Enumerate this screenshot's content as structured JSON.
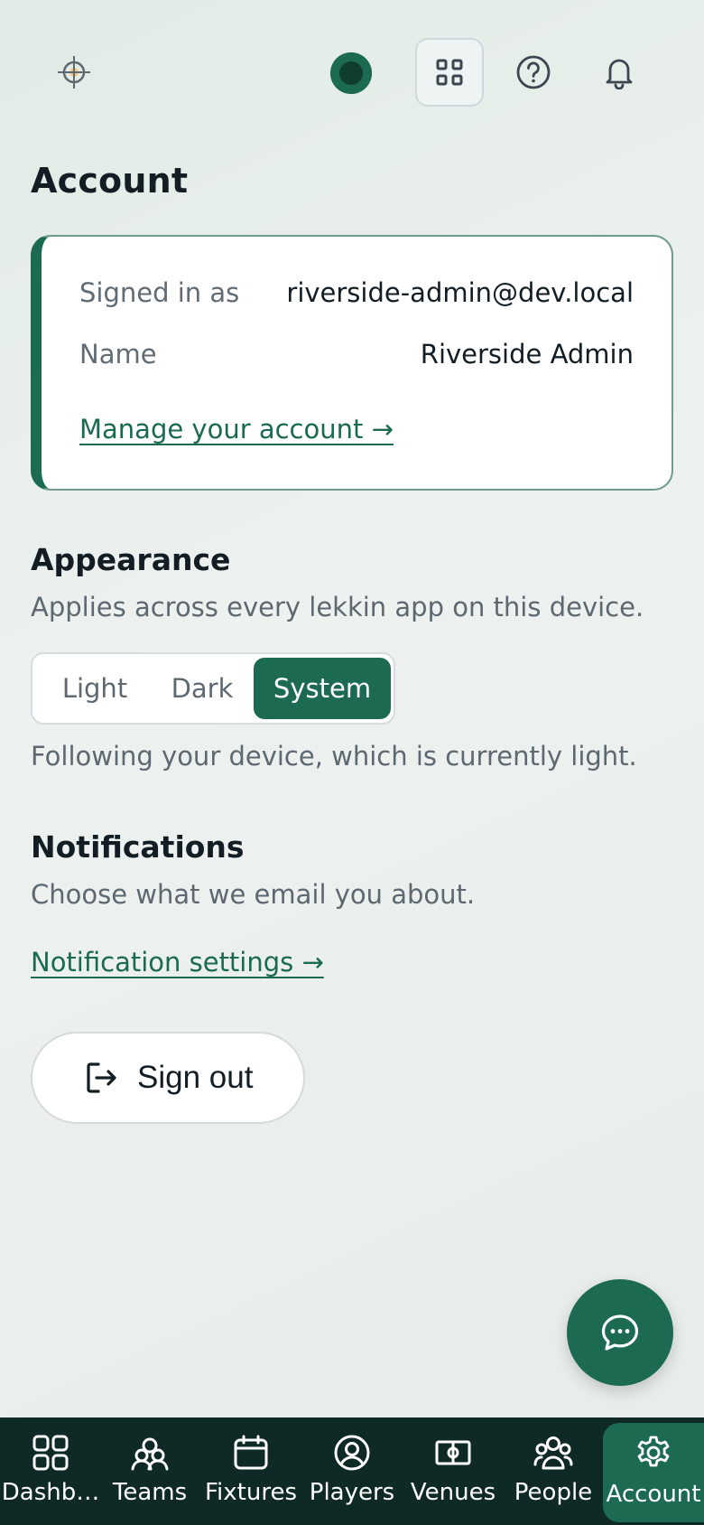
{
  "header": {
    "logo_icon": "crosshair-sun-icon",
    "status_icon": "status-dot-icon",
    "apps_icon": "grid-icon",
    "help_icon": "help-circle-icon",
    "bell_icon": "bell-icon"
  },
  "page": {
    "title": "Account"
  },
  "account": {
    "signed_in_label": "Signed in as",
    "signed_in_value": "riverside-admin@dev.local",
    "name_label": "Name",
    "name_value": "Riverside Admin",
    "manage_link": "Manage your account →"
  },
  "appearance": {
    "title": "Appearance",
    "description": "Applies across every lekkin app on this device.",
    "options": [
      "Light",
      "Dark",
      "System"
    ],
    "selected": "System",
    "note": "Following your device, which is currently light."
  },
  "notifications": {
    "title": "Notifications",
    "description": "Choose what we email you about.",
    "link": "Notification settings →"
  },
  "signout": {
    "label": "Sign out",
    "icon": "logout-icon"
  },
  "chat": {
    "icon": "chat-bubble-icon"
  },
  "nav": {
    "items": [
      {
        "label": "Dashb…",
        "icon": "dashboard-icon"
      },
      {
        "label": "Teams",
        "icon": "teams-icon"
      },
      {
        "label": "Fixtures",
        "icon": "calendar-icon"
      },
      {
        "label": "Players",
        "icon": "user-circle-icon"
      },
      {
        "label": "Venues",
        "icon": "venue-icon"
      },
      {
        "label": "People",
        "icon": "people-icon"
      },
      {
        "label": "Account",
        "icon": "gear-icon"
      }
    ],
    "active": "Account"
  },
  "colors": {
    "brand": "#1d6a52",
    "nav_background": "#0f2a26",
    "link": "#1a6a51",
    "muted_text": "#5e6870"
  }
}
